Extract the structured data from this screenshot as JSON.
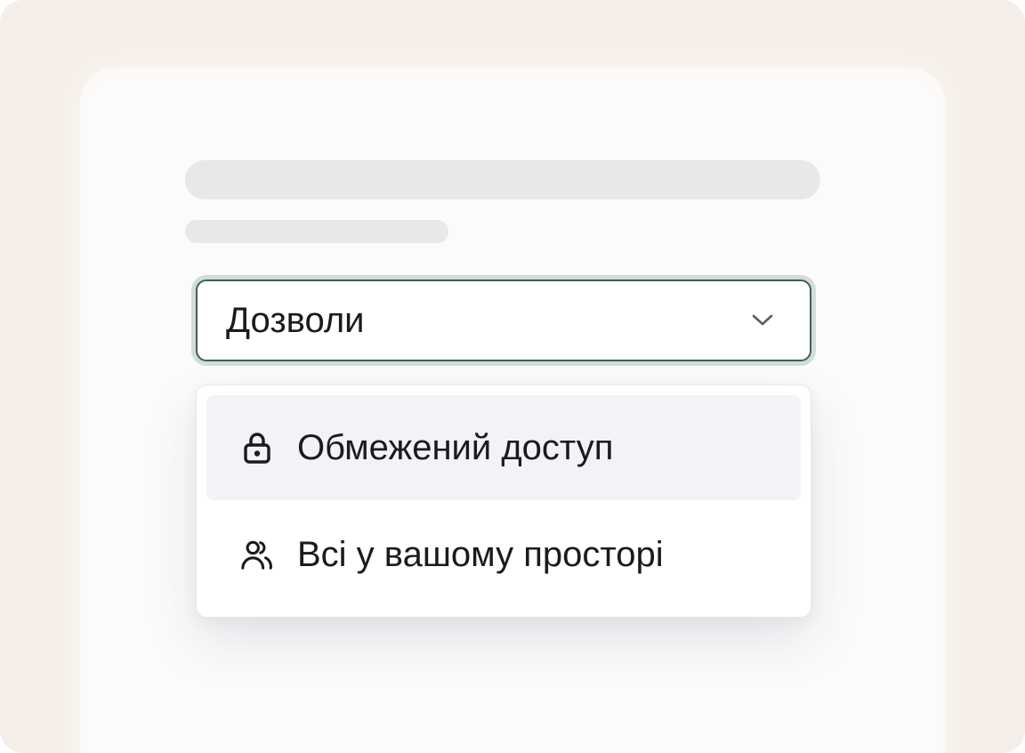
{
  "permissions_select": {
    "selected_label": "Дозволи",
    "chevron_icon": "chevron-down-icon",
    "accent_border": "#3b6253",
    "focus_ring": "#d3dcd8"
  },
  "dropdown": {
    "options": [
      {
        "label": "Обмежений доступ",
        "icon": "lock-icon",
        "highlighted": true
      },
      {
        "label": "Всі у вашому просторі",
        "icon": "users-icon",
        "highlighted": false
      }
    ]
  },
  "colors": {
    "outer_background": "#f6efe9",
    "card_background": "#fbfbfc",
    "skeleton": "#e8e7e9",
    "option_highlight": "#f3f2f6",
    "text": "#1b1b1f"
  }
}
